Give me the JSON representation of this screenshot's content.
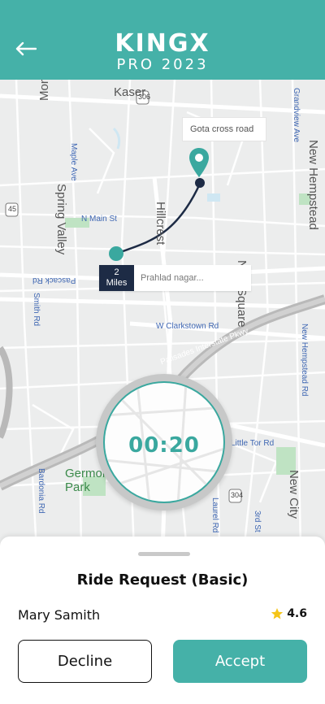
{
  "header": {
    "brand_main": "KINGX",
    "brand_sub": "PRO 2023",
    "background": "#45b1a8",
    "back_icon": "arrow-left-icon"
  },
  "map": {
    "destination": {
      "name": "Gota cross road",
      "icon": "map-pin-icon"
    },
    "origin": {
      "distance_value": "2",
      "distance_unit": "Miles",
      "name": "Prahlad nagar..."
    },
    "labels": {
      "monsey": "Monsey",
      "kaser": "Kaser",
      "maple_ave": "Maple Ave",
      "spring_valley": "Spring Valley",
      "n_main_st": "N Main St",
      "pascack_rd": "Pascack Rd",
      "smith_rd": "Smith Rd",
      "hillcrest": "Hillcrest",
      "new_square": "New Square",
      "new_hempstead": "New Hempstead",
      "grandview_ave": "Grandview Ave",
      "w_clarkstown_rd": "W Clarkstown Rd",
      "palisades": "Palisades Interstate Pkwy",
      "new_hempstead_rd": "New Hempstead Rd",
      "little_tor_rd": "Little Tor Rd",
      "germonds_park": "Germonds Park",
      "bardonia_rd": "Bardonia Rd",
      "laurel_rd": "Laurel Rd",
      "third_st": "3rd St",
      "new_city": "New City",
      "route_306": "306",
      "route_45": "45",
      "route_304": "304"
    },
    "route_color": "#1d2b45",
    "accent_color": "#3aa89f"
  },
  "timer": {
    "value": "00:20"
  },
  "sheet": {
    "title": "Ride Request (Basic)",
    "rider_name": "Mary Samith",
    "rating": "4.6",
    "rating_icon": "star-icon",
    "decline_label": "Decline",
    "accept_label": "Accept"
  }
}
